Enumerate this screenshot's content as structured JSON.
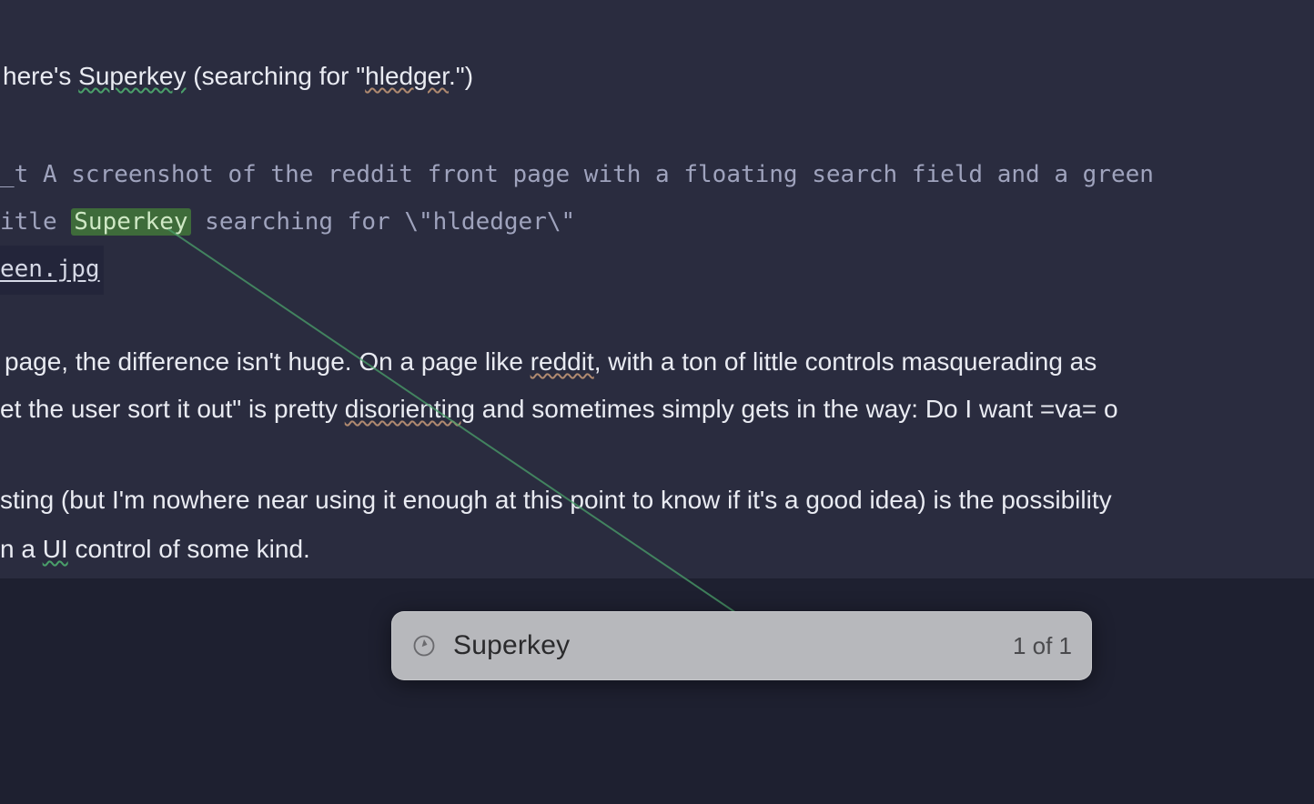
{
  "para1": {
    "pre": "here's ",
    "superkey": "Superkey",
    "mid": " (searching for \"",
    "hledger": "hledger",
    "post": ".\")"
  },
  "mono": {
    "line1": "_t A screenshot of the reddit front page with a floating search field and a green",
    "line2_pre": "itle ",
    "line2_hl": "Superkey",
    "line2_post": " searching for \\\"hldedger\\\"",
    "line3": "een.jpg"
  },
  "para3": {
    "a_pre": " page, the difference isn't huge. On a page like ",
    "a_reddit": "reddit",
    "a_post": ", with a ton of little controls masquerading as ",
    "b_pre": "et the user sort it out\" is pretty ",
    "b_dis": "disorienting",
    "b_post": " and sometimes simply gets in the way: Do I want =va= o"
  },
  "para4": {
    "a": "sting (but I'm nowhere near using it enough at this point to know if it's a good idea) is the possibility",
    "b_pre": "n a ",
    "b_ui": "UI",
    "b_post": " control of some kind."
  },
  "search": {
    "query": "Superkey",
    "count": "1 of 1"
  }
}
